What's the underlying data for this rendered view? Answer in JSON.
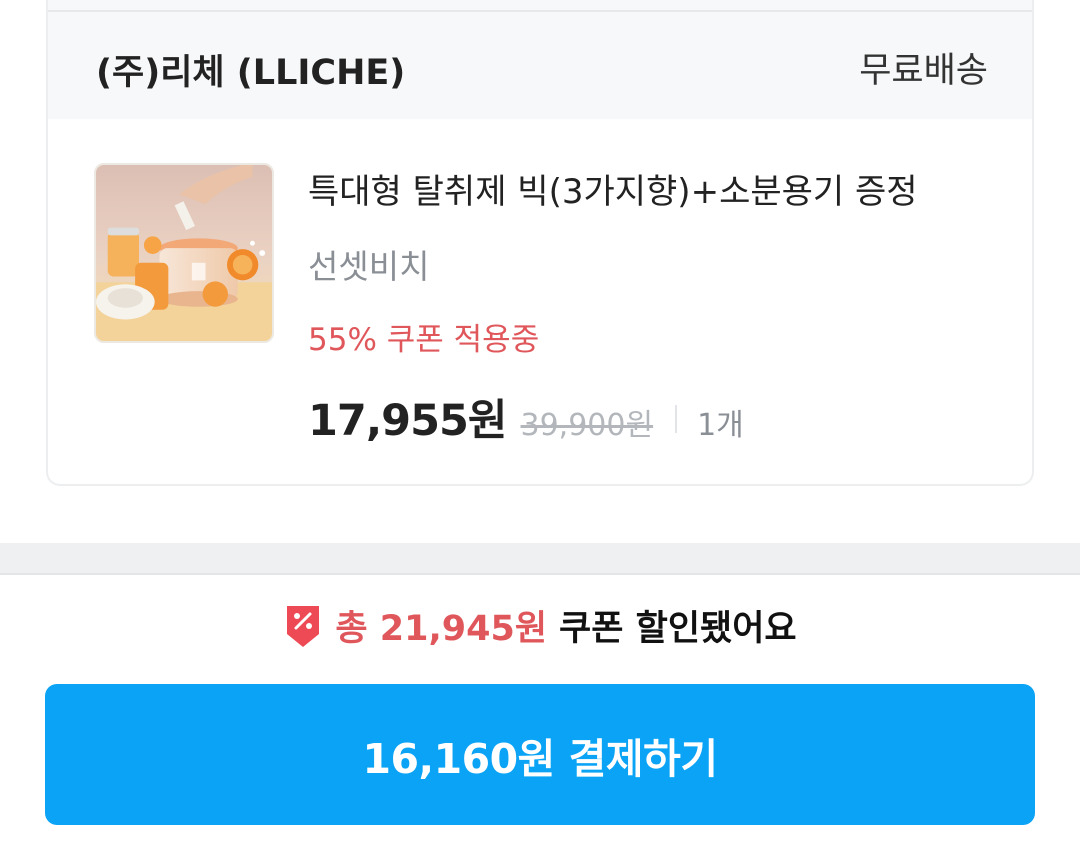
{
  "seller": {
    "name": "(주)리체 (LLICHE)",
    "shipping": "무료배송"
  },
  "product": {
    "title": "특대형 탈취제 빅(3가지향)+소분용기 증정",
    "option": "선셋비치",
    "coupon": "55% 쿠폰 적용중",
    "price": "17,955원",
    "original_price": "39,900원",
    "quantity": "1개"
  },
  "discount": {
    "icon": "discount-tag-icon",
    "highlight": "총 21,945원",
    "suffix": "쿠폰 할인됐어요"
  },
  "pay_button": {
    "label": "16,160원 결제하기"
  },
  "colors": {
    "accent": "#0aa3f5",
    "coupon_red": "#e0575b"
  }
}
